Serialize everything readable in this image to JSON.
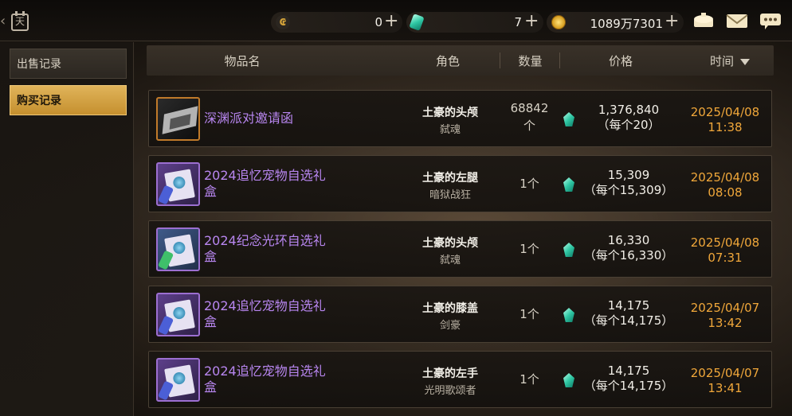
{
  "topbar": {
    "calendar_label": "天",
    "currencies": [
      {
        "icon": "tera-coin-icon",
        "glyph": "₢",
        "value": "0",
        "plus": "+"
      },
      {
        "icon": "gem-icon",
        "glyph": "",
        "value": "7",
        "plus": "+"
      },
      {
        "icon": "gold-coin-icon",
        "glyph": "",
        "value": "1089万7301",
        "plus": "+"
      }
    ]
  },
  "sidebar": {
    "tabs": [
      {
        "label": "出售记录",
        "active": false
      },
      {
        "label": "购买记录",
        "active": true
      }
    ]
  },
  "table": {
    "headers": {
      "item": "物品名",
      "character": "角色",
      "quantity": "数量",
      "price": "价格",
      "time": "时间"
    },
    "rows": [
      {
        "item": "深渊派对邀请函",
        "item_line2": "",
        "thumb": "dark",
        "character": "土豪的头颅",
        "class": "弑魂",
        "qty_line1": "68842",
        "qty_line2": "个",
        "price_total": "1,376,840",
        "price_each": "（每个20）",
        "date": "2025/04/08",
        "clock": "11:38"
      },
      {
        "item": "2024追忆宠物自选礼",
        "item_line2": "盒",
        "thumb": "box",
        "character": "土豪的左腿",
        "class": "暗狱战狂",
        "qty_line1": "1个",
        "qty_line2": "",
        "price_total": "15,309",
        "price_each": "（每个15,309）",
        "date": "2025/04/08",
        "clock": "08:08"
      },
      {
        "item": "2024纪念光环自选礼",
        "item_line2": "盒",
        "thumb": "box-alt",
        "character": "土豪的头颅",
        "class": "弑魂",
        "qty_line1": "1个",
        "qty_line2": "",
        "price_total": "16,330",
        "price_each": "（每个16,330）",
        "date": "2025/04/08",
        "clock": "07:31"
      },
      {
        "item": "2024追忆宠物自选礼",
        "item_line2": "盒",
        "thumb": "box",
        "character": "土豪的膝盖",
        "class": "剑豪",
        "qty_line1": "1个",
        "qty_line2": "",
        "price_total": "14,175",
        "price_each": "（每个14,175）",
        "date": "2025/04/07",
        "clock": "13:42"
      },
      {
        "item": "2024追忆宠物自选礼",
        "item_line2": "盒",
        "thumb": "box",
        "character": "土豪的左手",
        "class": "光明歌颂者",
        "qty_line1": "1个",
        "qty_line2": "",
        "price_total": "14,175",
        "price_each": "（每个14,175）",
        "date": "2025/04/07",
        "clock": "13:41"
      }
    ]
  },
  "colors": {
    "accent_gold": "#e0b45a",
    "item_purple": "#b886f0",
    "time_orange": "#f0a73a"
  }
}
